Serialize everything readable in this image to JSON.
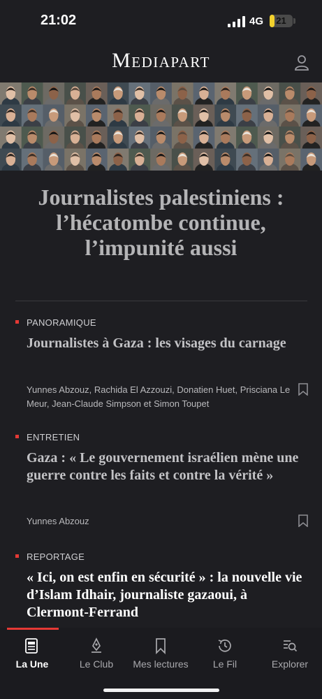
{
  "status_bar": {
    "time": "21:02",
    "network": "4G",
    "battery": "21",
    "battery_level": 0.21
  },
  "header": {
    "logo": "Mediapart"
  },
  "headline": "Journalistes palestiniens : l’hécatombe continue, l’impunité aussi",
  "articles": [
    {
      "kicker": "PANORAMIQUE",
      "title": "Journalistes à Gaza : les visages du carnage",
      "authors": "Yunnes Abzouz, Rachida El Azzouzi, Donatien Huet, Prisciana Le Meur, Jean-Claude Simpson et Simon Toupet"
    },
    {
      "kicker": "ENTRETIEN",
      "title": "Gaza : « Le gouvernement israélien mène une guerre contre les faits et contre la vérité »",
      "authors": "Yunnes Abzouz"
    },
    {
      "kicker": "REPORTAGE",
      "title": "« Ici, on est enfin en sécurité » : la nouvelle vie d’Islam Idhair, journaliste gazaoui, à Clermont-Ferrand",
      "authors": ""
    }
  ],
  "tabs": [
    {
      "label": "La Une",
      "icon": "newspaper-icon",
      "active": true
    },
    {
      "label": "Le Club",
      "icon": "pen-nib-icon",
      "active": false
    },
    {
      "label": "Mes lectures",
      "icon": "bookmark-icon",
      "active": false
    },
    {
      "label": "Le Fil",
      "icon": "clock-history-icon",
      "active": false
    },
    {
      "label": "Explorer",
      "icon": "search-list-icon",
      "active": false
    }
  ]
}
